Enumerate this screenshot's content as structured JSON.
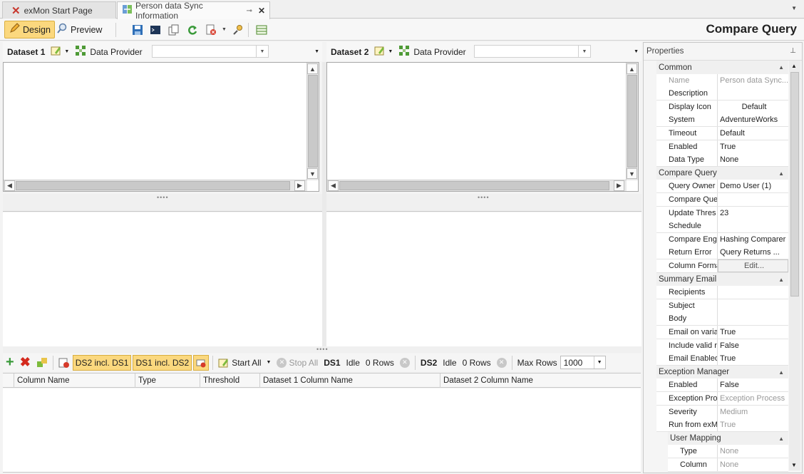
{
  "tabs": [
    {
      "label": "exMon Start Page"
    },
    {
      "label": "Person data Sync Information",
      "pin": "⊸",
      "close": "✕"
    }
  ],
  "toolbar": {
    "design_label": "Design",
    "preview_label": "Preview",
    "title": "Compare Query"
  },
  "dataset1": {
    "title": "Dataset 1",
    "provider_label": "Data Provider",
    "provider_value": ""
  },
  "dataset2": {
    "title": "Dataset 2",
    "provider_label": "Data Provider",
    "provider_value": ""
  },
  "bottom_toolbar": {
    "ds2_incl_ds1": "DS2 incl. DS1",
    "ds1_incl_ds2": "DS1 incl. DS2",
    "start_all": "Start All",
    "stop_all": "Stop All",
    "ds1_label": "DS1",
    "ds1_status": "Idle",
    "ds1_rows": "0 Rows",
    "ds2_label": "DS2",
    "ds2_status": "Idle",
    "ds2_rows": "0 Rows",
    "max_rows_label": "Max Rows",
    "max_rows_value": "1000"
  },
  "columns": [
    "Column Name",
    "Type",
    "Threshold",
    "Dataset 1 Column Name",
    "Dataset 2 Column Name"
  ],
  "properties": {
    "title": "Properties",
    "common": {
      "label": "Common",
      "rows": [
        {
          "k": "Name",
          "v": "Person data Sync..."
        },
        {
          "k": "Description",
          "v": ""
        },
        {
          "k": "Display Icon",
          "v": "Default"
        },
        {
          "k": "System",
          "v": "AdventureWorks"
        },
        {
          "k": "Timeout",
          "v": "Default"
        },
        {
          "k": "Enabled",
          "v": "True"
        },
        {
          "k": "Data Type",
          "v": "None"
        }
      ]
    },
    "compare_query": {
      "label": "Compare Query",
      "rows": [
        {
          "k": "Query Owner",
          "v": "Demo User (1)"
        },
        {
          "k": "Compare Que",
          "v": ""
        },
        {
          "k": "Update Thres",
          "v": "23"
        },
        {
          "k": "Schedule",
          "v": ""
        },
        {
          "k": "Compare Engi",
          "v": "Hashing Comparer"
        },
        {
          "k": "Return Error",
          "v": "Query Returns ..."
        },
        {
          "k": "Column Forma",
          "v": "Edit..."
        }
      ]
    },
    "summary_email": {
      "label": "Summary Email",
      "rows": [
        {
          "k": "Recipients",
          "v": ""
        },
        {
          "k": "Subject",
          "v": ""
        },
        {
          "k": "Body",
          "v": ""
        },
        {
          "k": "Email on varia",
          "v": "True"
        },
        {
          "k": "Include valid r",
          "v": "False"
        },
        {
          "k": "Email Enabled",
          "v": "True"
        }
      ]
    },
    "exception_manager": {
      "label": "Exception Manager",
      "rows": [
        {
          "k": "Enabled",
          "v": "False"
        },
        {
          "k": "Exception Pro",
          "v": "Exception Process"
        },
        {
          "k": "Severity",
          "v": "Medium"
        },
        {
          "k": "Run from exM",
          "v": "True"
        }
      ]
    },
    "user_mapping": {
      "label": "User Mapping",
      "rows": [
        {
          "k": "Type",
          "v": "None"
        },
        {
          "k": "Column",
          "v": "None"
        }
      ]
    }
  }
}
